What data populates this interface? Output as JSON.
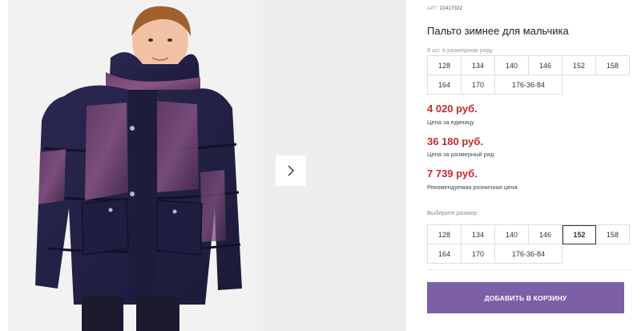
{
  "product": {
    "article_label": "АРТ:",
    "article_number": "22417022",
    "title": "Пальто зимнее для мальчика",
    "set_note": "9 шт. в размерном ряду",
    "set_sizes": [
      "128",
      "134",
      "140",
      "146",
      "152",
      "158",
      "164",
      "170",
      "176-36-84"
    ]
  },
  "prices": {
    "unit_price": "4 020 руб.",
    "unit_label": "Цена за единицу",
    "set_price": "36 180 руб.",
    "set_label": "Цена за размерный ряд",
    "retail_price": "7 739 руб.",
    "retail_label": "Рекомендуемая розничная цена",
    "price_color": "#c8282f"
  },
  "size_select": {
    "label": "Выберите размер:",
    "options": [
      "128",
      "134",
      "140",
      "146",
      "152",
      "158",
      "164",
      "170",
      "176-36-84"
    ],
    "selected": "152"
  },
  "actions": {
    "add_to_cart": "ДОБАВИТЬ В КОРЗИНУ",
    "button_color": "#7c5fa6"
  },
  "gallery": {
    "next_icon": "chevron-right-icon"
  }
}
